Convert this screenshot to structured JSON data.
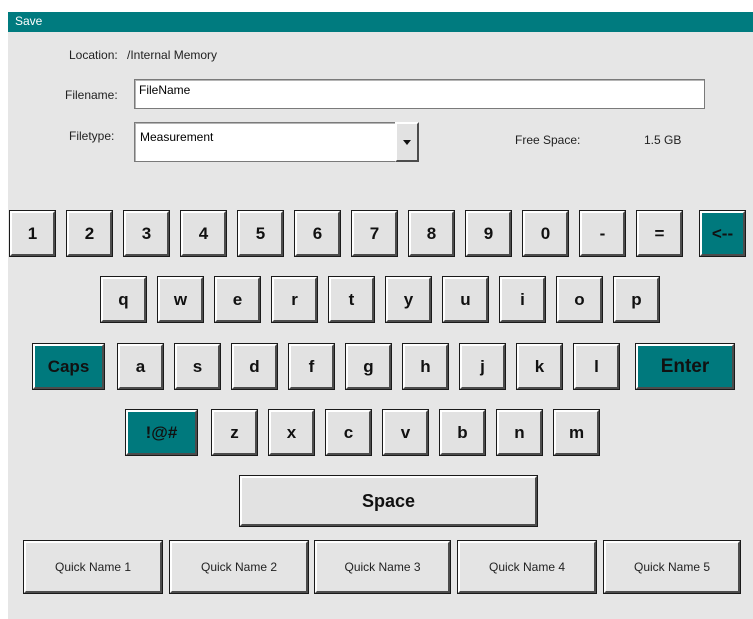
{
  "window": {
    "title": "Save"
  },
  "form": {
    "location_label": "Location:",
    "location_value": "/Internal Memory",
    "filename_label": "Filename:",
    "filename_value": "FileName",
    "filetype_label": "Filetype:",
    "filetype_value": "Measurement",
    "free_space_label": "Free Space:",
    "free_space_value": "1.5 GB"
  },
  "keyboard": {
    "row1": [
      "1",
      "2",
      "3",
      "4",
      "5",
      "6",
      "7",
      "8",
      "9",
      "0",
      "-",
      "=",
      "<--"
    ],
    "row2": [
      "q",
      "w",
      "e",
      "r",
      "t",
      "y",
      "u",
      "i",
      "o",
      "p"
    ],
    "row3": [
      "Caps",
      "a",
      "s",
      "d",
      "f",
      "g",
      "h",
      "j",
      "k",
      "l",
      "Enter"
    ],
    "row4": [
      "!@#",
      "z",
      "x",
      "c",
      "v",
      "b",
      "n",
      "m"
    ],
    "space": "Space"
  },
  "quick_names": [
    "Quick Name 1",
    "Quick Name 2",
    "Quick Name 3",
    "Quick Name 4",
    "Quick Name 5"
  ],
  "colors": {
    "accent": "#007b7f",
    "key_face": "#e2e2e2",
    "panel": "#e6e6e6"
  }
}
